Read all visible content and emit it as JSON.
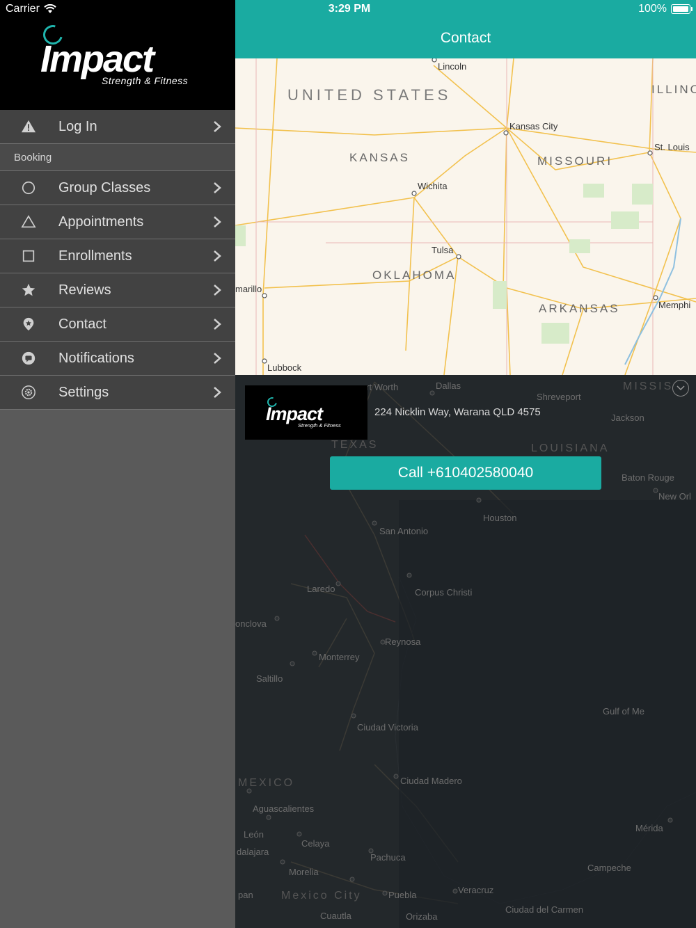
{
  "status_bar": {
    "carrier": "Carrier",
    "time": "3:29 PM",
    "battery": "100%"
  },
  "brand": {
    "name": "Impact",
    "tagline": "Strength & Fitness"
  },
  "menu": {
    "login": "Log In",
    "booking_header": "Booking",
    "items": [
      {
        "label": "Group Classes",
        "icon": "circle-icon"
      },
      {
        "label": "Appointments",
        "icon": "triangle-icon"
      },
      {
        "label": "Enrollments",
        "icon": "square-icon"
      },
      {
        "label": "Reviews",
        "icon": "star-icon"
      },
      {
        "label": "Contact",
        "icon": "location-pin-icon"
      },
      {
        "label": "Notifications",
        "icon": "chat-bubble-icon"
      },
      {
        "label": "Settings",
        "icon": "gear-icon"
      }
    ]
  },
  "navbar": {
    "title": "Contact"
  },
  "map": {
    "countries": {
      "us": "UNITED STATES",
      "mexico": "MEXICO"
    },
    "states": {
      "kansas": "KANSAS",
      "missouri": "MISSOURI",
      "oklahoma": "OKLAHOMA",
      "arkansas": "ARKANSAS",
      "illinois": "ILLINO",
      "texas": "TEXAS",
      "louisiana": "LOUISIANA",
      "mississippi": "MISSIS"
    },
    "cities": {
      "lincoln": "Lincoln",
      "kansas_city": "Kansas City",
      "st_louis": "St. Louis",
      "wichita": "Wichita",
      "tulsa": "Tulsa",
      "amarillo": "marillo",
      "memphis": "Memphi",
      "lubbock": "Lubbock",
      "fort_worth": "ort Worth",
      "dallas": "Dallas",
      "shreveport": "Shreveport",
      "jackson": "Jackson",
      "baton_rouge": "Baton Rouge",
      "new_orleans": "New Orl",
      "houston": "Houston",
      "san_antonio": "San Antonio",
      "laredo": "Laredo",
      "corpus_christi": "Corpus Christi",
      "monclova": "onclova",
      "reynosa": "Reynosa",
      "monterrey": "Monterrey",
      "saltillo": "Saltillo",
      "ciudad_victoria": "Ciudad Victoria",
      "ciudad_madero": "Ciudad Madero",
      "aguascalientes": "Aguascalientes",
      "leon": "León",
      "guadalajara": "dalajara",
      "celaya": "Celaya",
      "pachuca": "Pachuca",
      "morelia": "Morelia",
      "mexico_city": "Mexico City",
      "puebla": "Puebla",
      "veracruz": "Veracruz",
      "merida": "Mérida",
      "campeche": "Campeche",
      "ciudad_del_carmen": "Ciudad del Carmen",
      "cuautla": "Cuautla",
      "orizaba": "Orizaba",
      "toluca_pan": "pan",
      "gulf": "Gulf of Me"
    }
  },
  "contact": {
    "address": "224 Nicklin Way, Warana QLD 4575",
    "call_label": "Call +610402580040"
  },
  "colors": {
    "accent": "#1aaba1",
    "sidebar": "#424242",
    "brand_bg": "#000000"
  }
}
